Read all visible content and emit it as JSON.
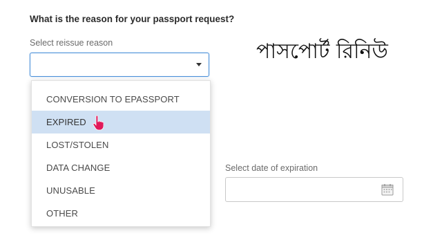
{
  "form": {
    "question": "What is the reason for your passport request?",
    "reissue_label": "Select reissue reason",
    "reissue_value": "",
    "reissue_options": [
      "CONVERSION TO EPASSPORT",
      "EXPIRED",
      "LOST/STOLEN",
      "DATA CHANGE",
      "UNUSABLE",
      "OTHER"
    ],
    "highlighted_option": "EXPIRED",
    "expiration_label": "Select date of expiration",
    "expiration_value": ""
  },
  "overlay": {
    "title": "পাসপোর্ট রিনিউ"
  },
  "icons": {
    "select_arrow": "chevron-down-icon",
    "cursor": "hand-pointer-icon",
    "calendar": "calendar-icon"
  },
  "colors": {
    "focus_border": "#4a90d9",
    "highlight": "#cfe0f3",
    "cursor_fill": "#e0195a"
  }
}
